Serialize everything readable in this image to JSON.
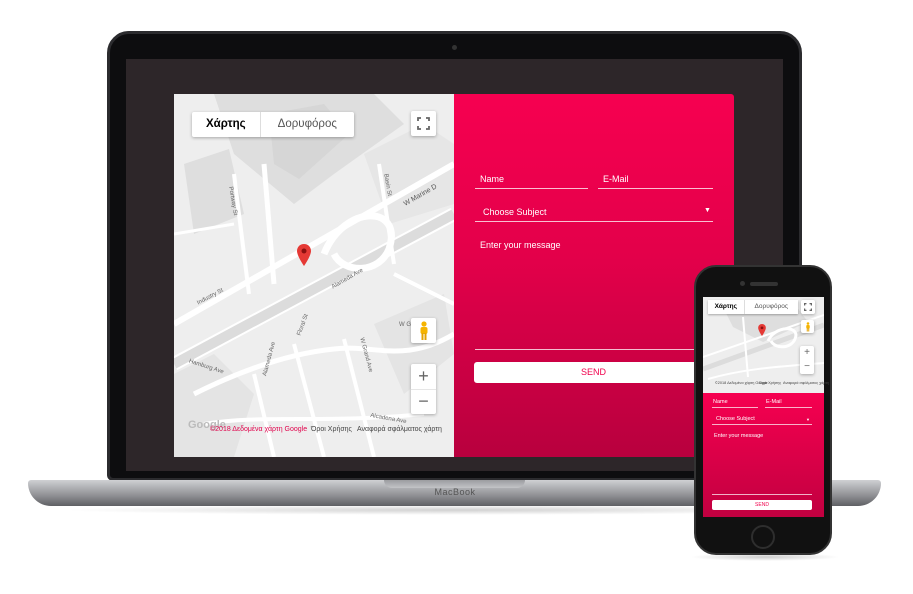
{
  "map": {
    "tabs": [
      {
        "label": "Χάρτης",
        "active": true
      },
      {
        "label": "Δορυφόρος",
        "active": false
      }
    ],
    "streets": [
      "W Marine D",
      "Basin St",
      "Portway St",
      "Industry St",
      "Alameda Ave",
      "Floral St",
      "Hamburg Ave",
      "Alameda Ave",
      "W Grand Ave",
      "Alcadena Ave",
      "W G"
    ],
    "footer": {
      "logo": "Google",
      "data": "©2018 Δεδομένα χάρτη Google",
      "terms": "Όροι Χρήσης",
      "report": "Αναφορά σφάλματος χάρτη"
    },
    "zoom_in": "+",
    "zoom_out": "−"
  },
  "form": {
    "name_label": "Name",
    "email_label": "E-Mail",
    "subject_label": "Choose Subject",
    "message_label": "Enter your message",
    "send_label": "SEND"
  },
  "device": {
    "brand": "MacBook"
  },
  "colors": {
    "accent": "#f0004c",
    "accent_dark": "#b8003e"
  }
}
